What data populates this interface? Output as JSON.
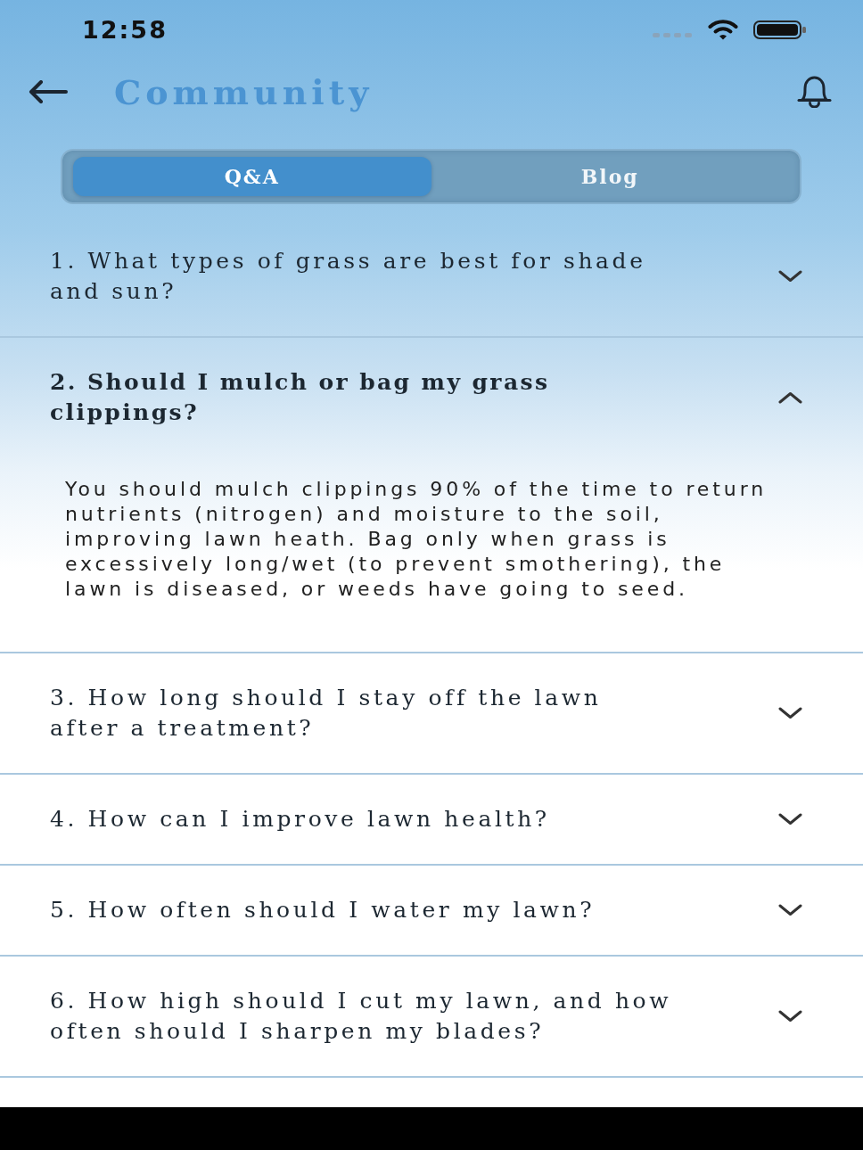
{
  "status_bar": {
    "time": "12:58"
  },
  "header": {
    "title": "Community"
  },
  "tabs": [
    {
      "label": "Q&A",
      "selected": true
    },
    {
      "label": "Blog",
      "selected": false
    }
  ],
  "faq": [
    {
      "question": "1. What types of grass are best for shade and sun?",
      "expanded": false
    },
    {
      "question": "2. Should I mulch or bag my grass clippings?",
      "expanded": true,
      "answer": "You should mulch clippings 90% of the time to return nutrients (nitrogen) and moisture to the soil, improving lawn heath. Bag only when grass is excessively long/wet (to prevent smothering), the lawn is diseased, or weeds have going to seed."
    },
    {
      "question": "3. How long should I stay off the lawn after a treatment?",
      "expanded": false
    },
    {
      "question": "4. How can I improve lawn health?",
      "expanded": false
    },
    {
      "question": "5. How often should I water my lawn?",
      "expanded": false
    },
    {
      "question": "6. How high should I cut my lawn, and how often should I sharpen my blades?",
      "expanded": false
    }
  ]
}
